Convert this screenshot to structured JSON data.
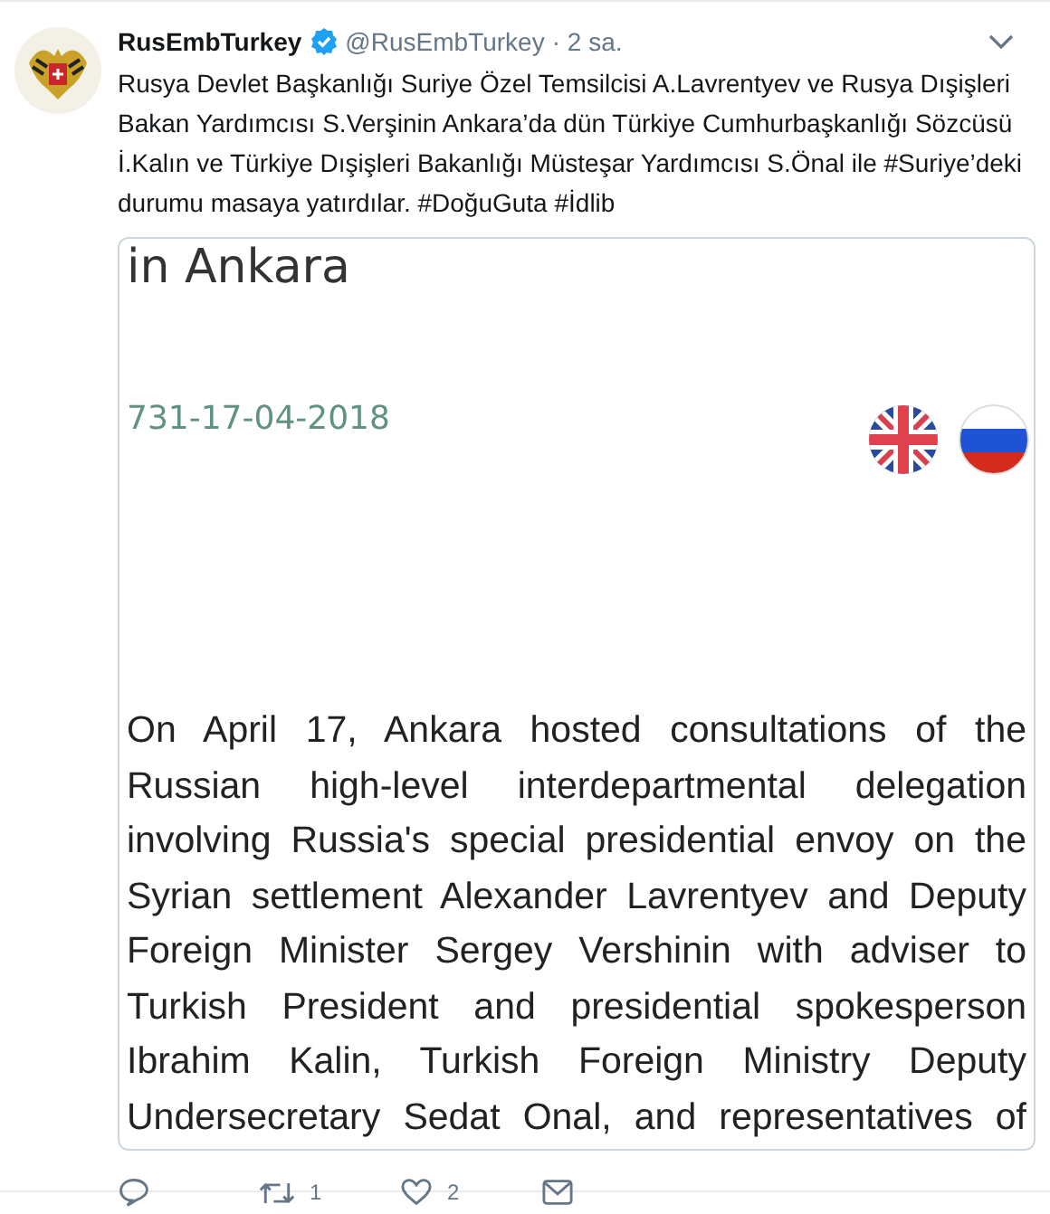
{
  "tweet": {
    "display_name": "RusEmbTurkey",
    "verified": true,
    "handle": "@RusEmbTurkey",
    "time": "· 2 sa.",
    "text": "Rusya Devlet Başkanlığı Suriye Özel Temsilcisi A.Lavrentyev ve Rusya Dışişleri Bakan Yardımcısı S.Verşinin Ankara’da dün Türkiye Cumhurbaşkanlığı Sözcüsü İ.Kalın ve Türkiye Dışişleri Bakanlığı Müsteşar Yardımcısı S.Önal ile #Suriye’deki durumu masaya yatırdılar. #DoğuGuta #İdlib",
    "document": {
      "heading": "in Ankara",
      "number": "731-17-04-2018",
      "body": "On April 17, Ankara hosted consultations of the Russian high-level interdepartmental delegation involving Russia's special presidential envoy on the Syrian settlement Alexander Lavrentyev and Deputy Foreign Minister Sergey Vershinin with adviser to Turkish President and presidential spokesperson Ibrahim Kalin, Turkish Foreign Ministry Deputy Undersecretary Sedat Onal, and representatives of"
    },
    "actions": [
      {
        "kind": "reply"
      },
      {
        "kind": "retweet",
        "count": "1"
      },
      {
        "kind": "like",
        "count": "2"
      },
      {
        "kind": "message"
      }
    ]
  }
}
